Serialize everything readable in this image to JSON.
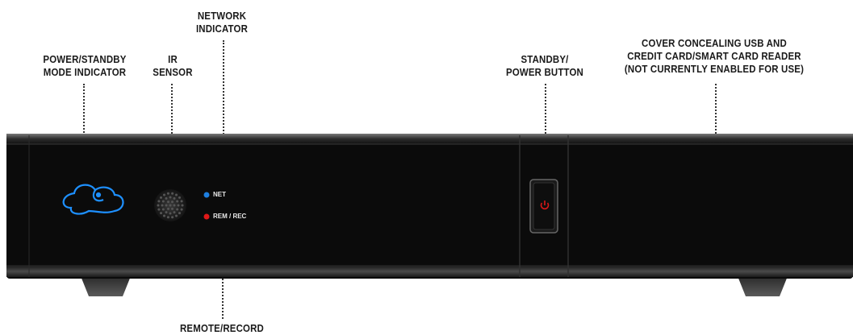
{
  "colors": {
    "housing": "#0a0a0a",
    "logo_blue": "#1e90ff",
    "net_led": "#1e7fe0",
    "rec_led": "#e01818",
    "power_red": "#d81818"
  },
  "callouts": {
    "power_standby": "POWER/STANDBY\nMODE INDICATOR",
    "ir_sensor": "IR\nSENSOR",
    "network": "NETWORK\nINDICATOR",
    "standby_button": "STANDBY/\nPOWER BUTTON",
    "cover": "COVER CONCEALING USB AND\nCREDIT CARD/SMART CARD READER\n(NOT CURRENTLY ENABLED FOR USE)",
    "remote_record": "REMOTE/RECORD"
  },
  "panel_text": {
    "net": "NET",
    "rem_rec": "REM / REC"
  },
  "icons": {
    "logo": "cloud-logo-icon",
    "ir": "ir-sensor-grille",
    "power": "power-icon"
  }
}
